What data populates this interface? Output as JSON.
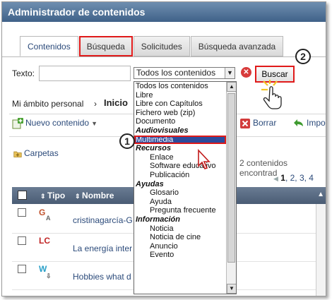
{
  "window": {
    "title": "Administrador de contenidos"
  },
  "tabs": [
    {
      "label": "Contenidos"
    },
    {
      "label": "Búsqueda"
    },
    {
      "label": "Solicitudes"
    },
    {
      "label": "Búsqueda avanzada"
    }
  ],
  "search": {
    "text_label": "Texto:",
    "text_value": "",
    "scope_selected": "Todos los contenidos",
    "button_label": "Buscar"
  },
  "callouts": {
    "one": "1",
    "two": "2"
  },
  "breadcrumb": {
    "root": "Mi ámbito personal",
    "separator": "›",
    "current": "Inicio"
  },
  "toolbar": {
    "new_content": "Nuevo contenido",
    "delete": "Borrar",
    "import": "Impo"
  },
  "folders_label": "Carpetas",
  "results_text": "2 contenidos encontrad",
  "pager": {
    "arrow": "◀",
    "current": "1",
    "others": ", 2, 3, 4"
  },
  "table": {
    "headers": {
      "type": "Tipo",
      "name": "Nombre"
    },
    "rows": [
      {
        "type_icon": "G",
        "name": "cristinagarcía-G"
      },
      {
        "type_icon": "LC",
        "name": "La energía inter"
      },
      {
        "type_icon": "W",
        "name": "Hobbies what d"
      }
    ]
  },
  "dropdown_options": [
    {
      "label": "Todos los contenidos",
      "kind": "opt"
    },
    {
      "label": "Libre",
      "kind": "opt"
    },
    {
      "label": "Libre con Capítulos",
      "kind": "opt"
    },
    {
      "label": "Fichero web (zip)",
      "kind": "opt"
    },
    {
      "label": "Documento",
      "kind": "opt"
    },
    {
      "label": "Audiovisuales",
      "kind": "grp"
    },
    {
      "label": "Multimedia",
      "kind": "sel"
    },
    {
      "label": "Recursos",
      "kind": "grp"
    },
    {
      "label": "Enlace",
      "kind": "ind"
    },
    {
      "label": "Software educativo",
      "kind": "ind"
    },
    {
      "label": "Publicación",
      "kind": "ind"
    },
    {
      "label": "Ayudas",
      "kind": "grp"
    },
    {
      "label": "Glosario",
      "kind": "ind"
    },
    {
      "label": "Ayuda",
      "kind": "ind"
    },
    {
      "label": "Pregunta frecuente",
      "kind": "ind"
    },
    {
      "label": "Información",
      "kind": "grp"
    },
    {
      "label": "Noticia",
      "kind": "ind"
    },
    {
      "label": "Noticia de cine",
      "kind": "ind"
    },
    {
      "label": "Anuncio",
      "kind": "ind"
    },
    {
      "label": "Evento",
      "kind": "ind"
    }
  ],
  "colors": {
    "titlebar": "#3f6188",
    "highlight": "#e01a1a",
    "selection": "#2c4b9c",
    "link": "#2b4a7a"
  },
  "icons": [
    "plus-icon",
    "delete-icon",
    "import-icon",
    "folder-icon",
    "clear-icon",
    "hand-cursor-icon",
    "arrow-cursor-icon"
  ]
}
